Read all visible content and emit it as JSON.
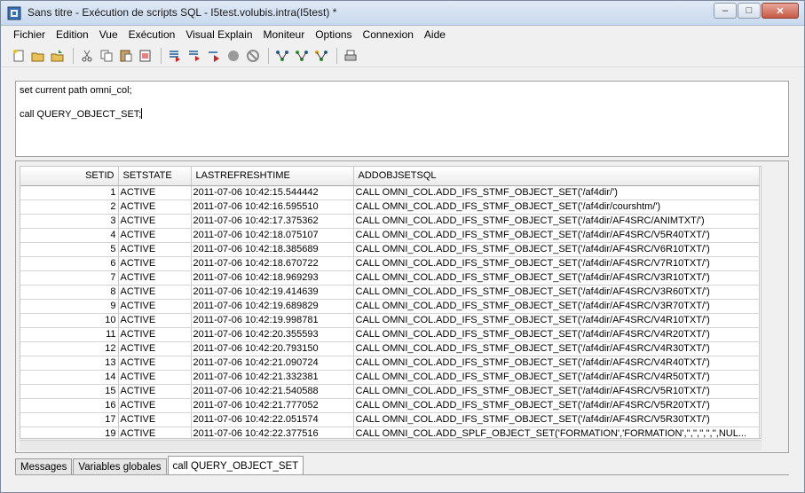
{
  "window": {
    "title": "Sans titre - Exécution de scripts SQL - I5test.volubis.intra(I5test) *",
    "minimize": "–",
    "maximize": "□",
    "close": "✕"
  },
  "menu": [
    "Fichier",
    "Edition",
    "Vue",
    "Exécution",
    "Visual Explain",
    "Moniteur",
    "Options",
    "Connexion",
    "Aide"
  ],
  "editor": {
    "lines": [
      "set current path omni_col;",
      "",
      "call QUERY_OBJECT_SET;"
    ]
  },
  "grid": {
    "columns": [
      "SETID",
      "SETSTATE",
      "LASTREFRESHTIME",
      "ADDOBJSETSQL"
    ],
    "rows": [
      [
        "1",
        "ACTIVE",
        "2011-07-06 10:42:15.544442",
        "CALL OMNI_COL.ADD_IFS_STMF_OBJECT_SET('/af4dir/')"
      ],
      [
        "2",
        "ACTIVE",
        "2011-07-06 10:42:16.595510",
        "CALL OMNI_COL.ADD_IFS_STMF_OBJECT_SET('/af4dir/courshtm/')"
      ],
      [
        "3",
        "ACTIVE",
        "2011-07-06 10:42:17.375362",
        "CALL OMNI_COL.ADD_IFS_STMF_OBJECT_SET('/af4dir/AF4SRC/ANIMTXT/')"
      ],
      [
        "4",
        "ACTIVE",
        "2011-07-06 10:42:18.075107",
        "CALL OMNI_COL.ADD_IFS_STMF_OBJECT_SET('/af4dir/AF4SRC/V5R40TXT/')"
      ],
      [
        "5",
        "ACTIVE",
        "2011-07-06 10:42:18.385689",
        "CALL OMNI_COL.ADD_IFS_STMF_OBJECT_SET('/af4dir/AF4SRC/V6R10TXT/')"
      ],
      [
        "6",
        "ACTIVE",
        "2011-07-06 10:42:18.670722",
        "CALL OMNI_COL.ADD_IFS_STMF_OBJECT_SET('/af4dir/AF4SRC/V7R10TXT/')"
      ],
      [
        "7",
        "ACTIVE",
        "2011-07-06 10:42:18.969293",
        "CALL OMNI_COL.ADD_IFS_STMF_OBJECT_SET('/af4dir/AF4SRC/V3R10TXT/')"
      ],
      [
        "8",
        "ACTIVE",
        "2011-07-06 10:42:19.414639",
        "CALL OMNI_COL.ADD_IFS_STMF_OBJECT_SET('/af4dir/AF4SRC/V3R60TXT/')"
      ],
      [
        "9",
        "ACTIVE",
        "2011-07-06 10:42:19.689829",
        "CALL OMNI_COL.ADD_IFS_STMF_OBJECT_SET('/af4dir/AF4SRC/V3R70TXT/')"
      ],
      [
        "10",
        "ACTIVE",
        "2011-07-06 10:42:19.998781",
        "CALL OMNI_COL.ADD_IFS_STMF_OBJECT_SET('/af4dir/AF4SRC/V4R10TXT/')"
      ],
      [
        "11",
        "ACTIVE",
        "2011-07-06 10:42:20.355593",
        "CALL OMNI_COL.ADD_IFS_STMF_OBJECT_SET('/af4dir/AF4SRC/V4R20TXT/')"
      ],
      [
        "12",
        "ACTIVE",
        "2011-07-06 10:42:20.793150",
        "CALL OMNI_COL.ADD_IFS_STMF_OBJECT_SET('/af4dir/AF4SRC/V4R30TXT/')"
      ],
      [
        "13",
        "ACTIVE",
        "2011-07-06 10:42:21.090724",
        "CALL OMNI_COL.ADD_IFS_STMF_OBJECT_SET('/af4dir/AF4SRC/V4R40TXT/')"
      ],
      [
        "14",
        "ACTIVE",
        "2011-07-06 10:42:21.332381",
        "CALL OMNI_COL.ADD_IFS_STMF_OBJECT_SET('/af4dir/AF4SRC/V4R50TXT/')"
      ],
      [
        "15",
        "ACTIVE",
        "2011-07-06 10:42:21.540588",
        "CALL OMNI_COL.ADD_IFS_STMF_OBJECT_SET('/af4dir/AF4SRC/V5R10TXT/')"
      ],
      [
        "16",
        "ACTIVE",
        "2011-07-06 10:42:21.777052",
        "CALL OMNI_COL.ADD_IFS_STMF_OBJECT_SET('/af4dir/AF4SRC/V5R20TXT/')"
      ],
      [
        "17",
        "ACTIVE",
        "2011-07-06 10:42:22.051574",
        "CALL OMNI_COL.ADD_IFS_STMF_OBJECT_SET('/af4dir/AF4SRC/V5R30TXT/')"
      ],
      [
        "19",
        "ACTIVE",
        "2011-07-06 10:42:22.377516",
        "CALL OMNI_COL.ADD_SPLF_OBJECT_SET('FORMATION','FORMATION','','','','','',NUL..."
      ]
    ]
  },
  "tabs": [
    "Messages",
    "Variables globales",
    "call QUERY_OBJECT_SET"
  ],
  "toolbar_icons": [
    "new-icon",
    "open-icon",
    "save-icon",
    "cut-icon",
    "copy-icon",
    "paste-icon",
    "print-icon",
    "run-all-icon",
    "run-from-icon",
    "run-statement-icon",
    "stop-icon",
    "cancel-icon",
    "explain-icon",
    "run-explain-icon",
    "visual-explain-icon",
    "print-setup-icon"
  ]
}
